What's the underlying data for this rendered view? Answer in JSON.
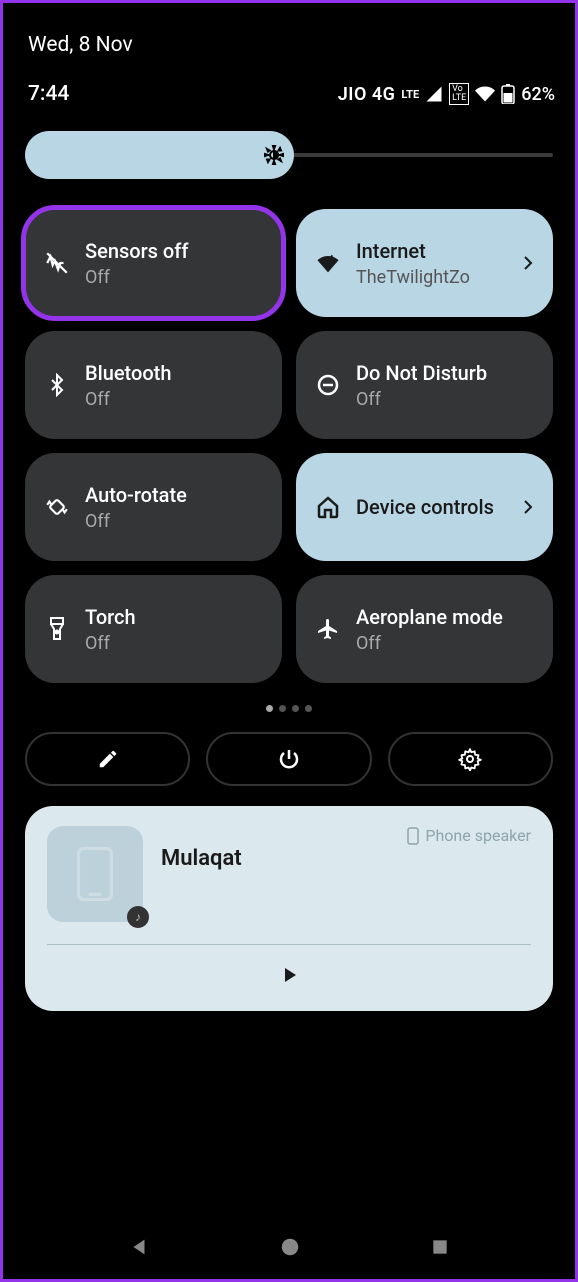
{
  "date": "Wed, 8 Nov",
  "time": "7:44",
  "status": {
    "network": "JIO 4G",
    "lte": "LTE",
    "battery_pct": "62%"
  },
  "tiles": [
    {
      "title": "Sensors off",
      "sub": "Off",
      "icon": "sensors-off-icon"
    },
    {
      "title": "Internet",
      "sub": "TheTwilightZo",
      "icon": "wifi-icon"
    },
    {
      "title": "Bluetooth",
      "sub": "Off",
      "icon": "bluetooth-icon"
    },
    {
      "title": "Do Not Disturb",
      "sub": "Off",
      "icon": "dnd-icon"
    },
    {
      "title": "Auto-rotate",
      "sub": "Off",
      "icon": "rotate-icon"
    },
    {
      "title": "Device controls",
      "sub": "",
      "icon": "home-icon"
    },
    {
      "title": "Torch",
      "sub": "Off",
      "icon": "torch-icon"
    },
    {
      "title": "Aeroplane mode",
      "sub": "Off",
      "icon": "airplane-icon"
    }
  ],
  "media": {
    "title": "Mulaqat",
    "output": "Phone speaker"
  },
  "colors": {
    "active_tile": "#b9d6e4",
    "inactive_tile": "#333537",
    "highlight": "#9333ea",
    "media_card": "#dbe8ed"
  }
}
